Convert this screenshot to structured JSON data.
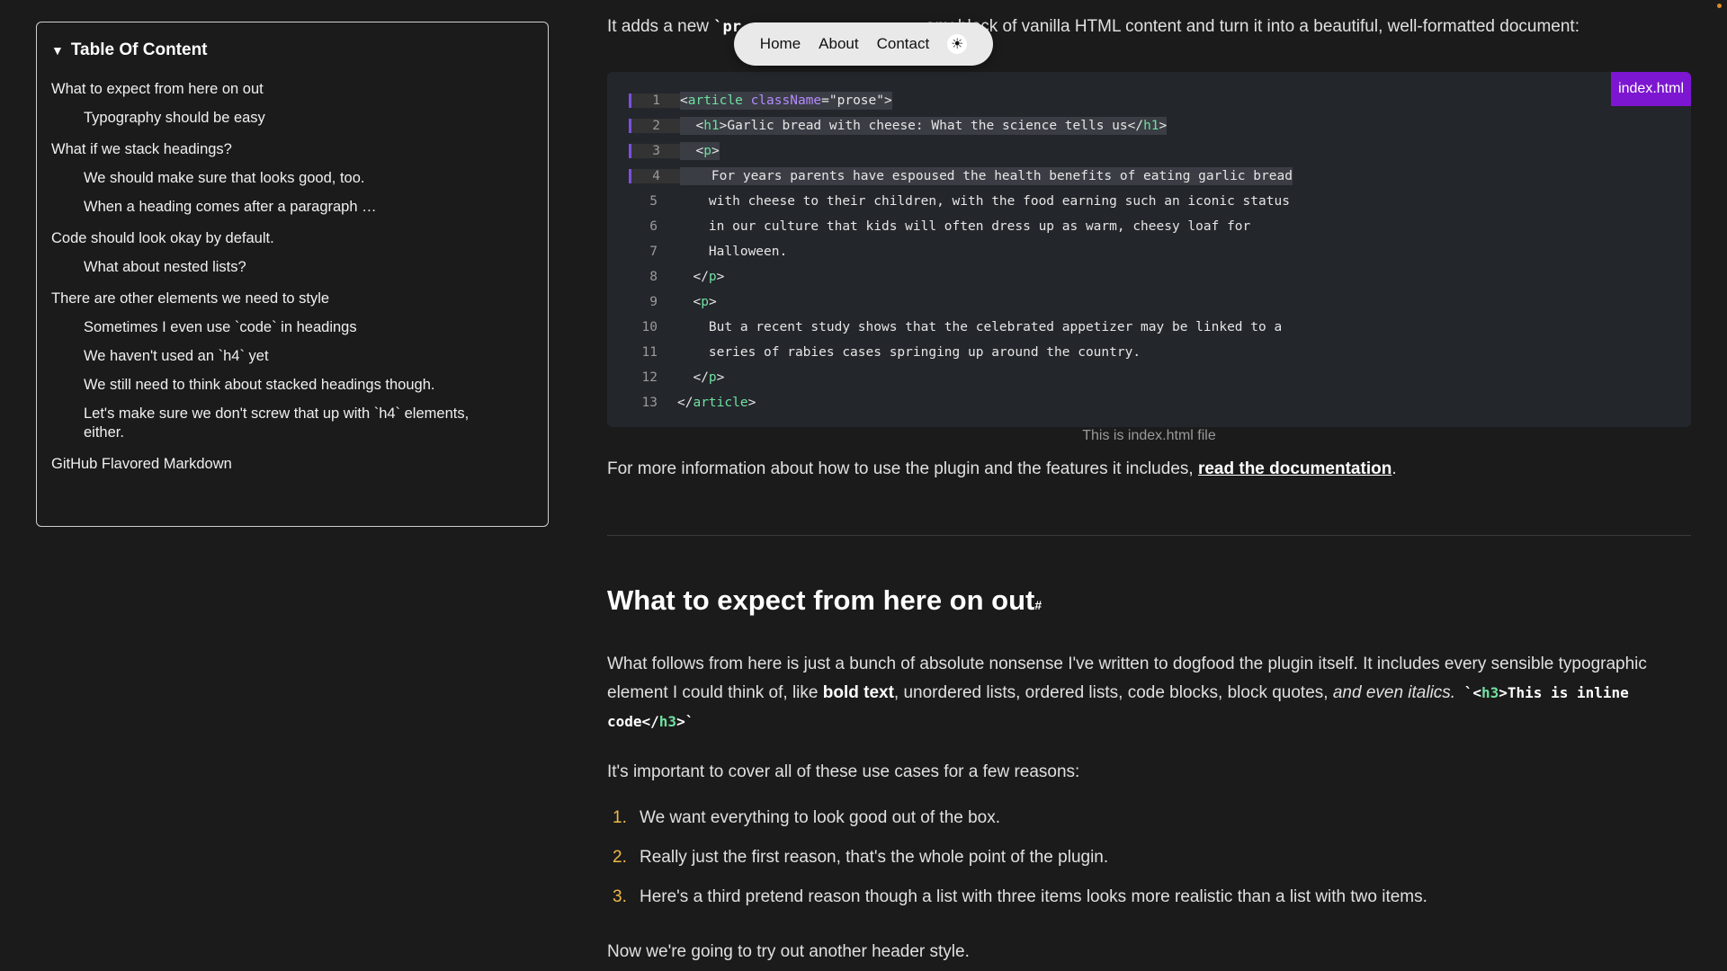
{
  "toc": {
    "title": "Table Of Content",
    "items": [
      {
        "label": "What to expect from here on out",
        "level": 1
      },
      {
        "label": "Typography should be easy",
        "level": 2
      },
      {
        "label": "What if we stack headings?",
        "level": 1
      },
      {
        "label": "We should make sure that looks good, too.",
        "level": 2
      },
      {
        "label": "When a heading comes after a paragraph …",
        "level": 2
      },
      {
        "label": "Code should look okay by default.",
        "level": 1
      },
      {
        "label": "What about nested lists?",
        "level": 2
      },
      {
        "label": "There are other elements we need to style",
        "level": 1
      },
      {
        "label": "Sometimes I even use `code` in headings",
        "level": 2
      },
      {
        "label": "We haven't used an `h4` yet",
        "level": 2
      },
      {
        "label": "We still need to think about stacked headings though.",
        "level": 2
      },
      {
        "label": "Let's make sure we don't screw that up with `h4` elements, either.",
        "level": 2
      },
      {
        "label": "GitHub Flavored Markdown",
        "level": 1
      }
    ]
  },
  "nav": {
    "home": "Home",
    "about": "About",
    "contact": "Contact",
    "theme_icon": "sun-icon"
  },
  "intro": {
    "before": "It adds a new ",
    "code": "`pr",
    "after": "any block of vanilla HTML content and turn it into a beautiful, well-formatted document:"
  },
  "codeblock": {
    "filename": "index.html",
    "caption": "This is index.html file",
    "lines": [
      {
        "n": "1",
        "hl": true,
        "parts": [
          [
            "",
            "<"
          ],
          [
            "tg",
            "article"
          ],
          [
            "",
            " "
          ],
          [
            "at",
            "className"
          ],
          [
            "",
            "=\"prose\">"
          ]
        ]
      },
      {
        "n": "2",
        "hl": true,
        "parts": [
          [
            "",
            "  <"
          ],
          [
            "tg",
            "h1"
          ],
          [
            "",
            ">Garlic bread with cheese: What the science tells us</"
          ],
          [
            "tg",
            "h1"
          ],
          [
            "",
            ">"
          ]
        ]
      },
      {
        "n": "3",
        "hl": true,
        "parts": [
          [
            "",
            "  <"
          ],
          [
            "tg",
            "p"
          ],
          [
            "",
            ">"
          ]
        ]
      },
      {
        "n": "4",
        "hl": true,
        "parts": [
          [
            "",
            "    For years parents have espoused the health benefits of eating garlic bread"
          ]
        ]
      },
      {
        "n": "5",
        "hl": false,
        "parts": [
          [
            "",
            "    with cheese to their children, with the food earning such an iconic status"
          ]
        ]
      },
      {
        "n": "6",
        "hl": false,
        "parts": [
          [
            "",
            "    in our culture that kids will often dress up as warm, cheesy loaf for"
          ]
        ]
      },
      {
        "n": "7",
        "hl": false,
        "parts": [
          [
            "",
            "    Halloween."
          ]
        ]
      },
      {
        "n": "8",
        "hl": false,
        "parts": [
          [
            "",
            "  </"
          ],
          [
            "tg",
            "p"
          ],
          [
            "",
            ">"
          ]
        ]
      },
      {
        "n": "9",
        "hl": false,
        "parts": [
          [
            "",
            "  <"
          ],
          [
            "tg",
            "p"
          ],
          [
            "",
            ">"
          ]
        ]
      },
      {
        "n": "10",
        "hl": false,
        "parts": [
          [
            "",
            "    But a recent study shows that the celebrated appetizer may be linked to a"
          ]
        ]
      },
      {
        "n": "11",
        "hl": false,
        "parts": [
          [
            "",
            "    series of rabies cases springing up around the country."
          ]
        ]
      },
      {
        "n": "12",
        "hl": false,
        "parts": [
          [
            "",
            "  </"
          ],
          [
            "tg",
            "p"
          ],
          [
            "",
            ">"
          ]
        ]
      },
      {
        "n": "13",
        "hl": false,
        "parts": [
          [
            "",
            "</"
          ],
          [
            "tg",
            "article"
          ],
          [
            "",
            ">"
          ]
        ]
      }
    ]
  },
  "more": {
    "text": "For more information about how to use the plugin and the features it includes, ",
    "link": "read the documentation",
    "end": "."
  },
  "section": {
    "heading": "What to expect from here on out",
    "hash": "#",
    "p1_a": "What follows from here is just a bunch of absolute nonsense I've written to dogfood the plugin itself. It includes every sensible typographic element I could think of, like ",
    "p1_bold": "bold text",
    "p1_b": ", unordered lists, ordered lists, code blocks, block quotes, ",
    "p1_italic": "and even italics.",
    "p1_code_1": " `<",
    "p1_code_tag": "h3",
    "p1_code_2": ">This is inline code</",
    "p1_code_tag2": "h3",
    "p1_code_3": ">`",
    "p2": "It's important to cover all of these use cases for a few reasons:",
    "list": [
      {
        "num": "1.",
        "text": "We want everything to look good out of the box."
      },
      {
        "num": "2.",
        "text": "Really just the first reason, that's the whole point of the plugin."
      },
      {
        "num": "3.",
        "text": "Here's a third pretend reason though a list with three items looks more realistic than a list with two items."
      }
    ],
    "p3": "Now we're going to try out another header style."
  }
}
